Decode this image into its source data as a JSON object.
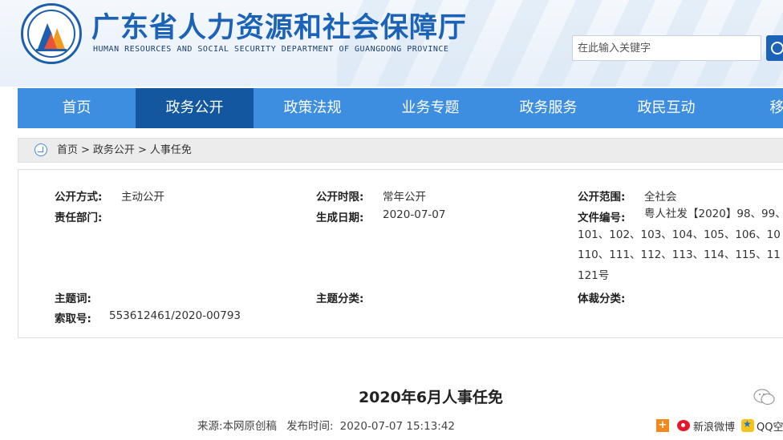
{
  "header": {
    "title": "广东省人力资源和社会保障厅",
    "subtitle": "HUMAN RESOURCES AND SOCIAL SECURITY DEPARTMENT OF GUANGDONG PROVINCE",
    "search_placeholder": "在此输入关键字"
  },
  "nav": {
    "items": [
      "首页",
      "政务公开",
      "政策法规",
      "业务专题",
      "政务服务",
      "政民互动",
      "移动"
    ],
    "active": "政务公开"
  },
  "breadcrumb": {
    "items": [
      "首页",
      "政务公开",
      "人事任免"
    ],
    "separator": ">"
  },
  "meta": {
    "disclosure_method_label": "公开方式:",
    "disclosure_method": "主动公开",
    "disclosure_period_label": "公开时限:",
    "disclosure_period": "常年公开",
    "disclosure_scope_label": "公开范围:",
    "disclosure_scope": "全社会",
    "department_label": "责任部门:",
    "department": "",
    "created_date_label": "生成日期:",
    "created_date": "2020-07-07",
    "doc_number_label": "文件编号:",
    "doc_number_lines": [
      "粤人社发【2020】98、99、",
      "101、102、103、104、105、106、10",
      "110、111、112、113、114、115、11",
      "121号"
    ],
    "keywords_label": "主题词:",
    "keywords": "",
    "topic_label": "主题分类:",
    "topic": "",
    "genre_label": "体裁分类:",
    "genre": "",
    "index_label": "索取号:",
    "index_number": "553612461/2020-00793"
  },
  "article": {
    "title": "2020年6月人事任免",
    "source_label": "来源:",
    "source": "本网原创稿",
    "publish_label": "发布时间:",
    "publish_time": "2020-07-07 15:13:42"
  },
  "share": {
    "weibo": "新浪微博",
    "qq": "QQ空"
  },
  "colors": {
    "brand_blue": "#1c63b7",
    "nav_blue": "#3d8ee0",
    "nav_active": "#12579f"
  }
}
